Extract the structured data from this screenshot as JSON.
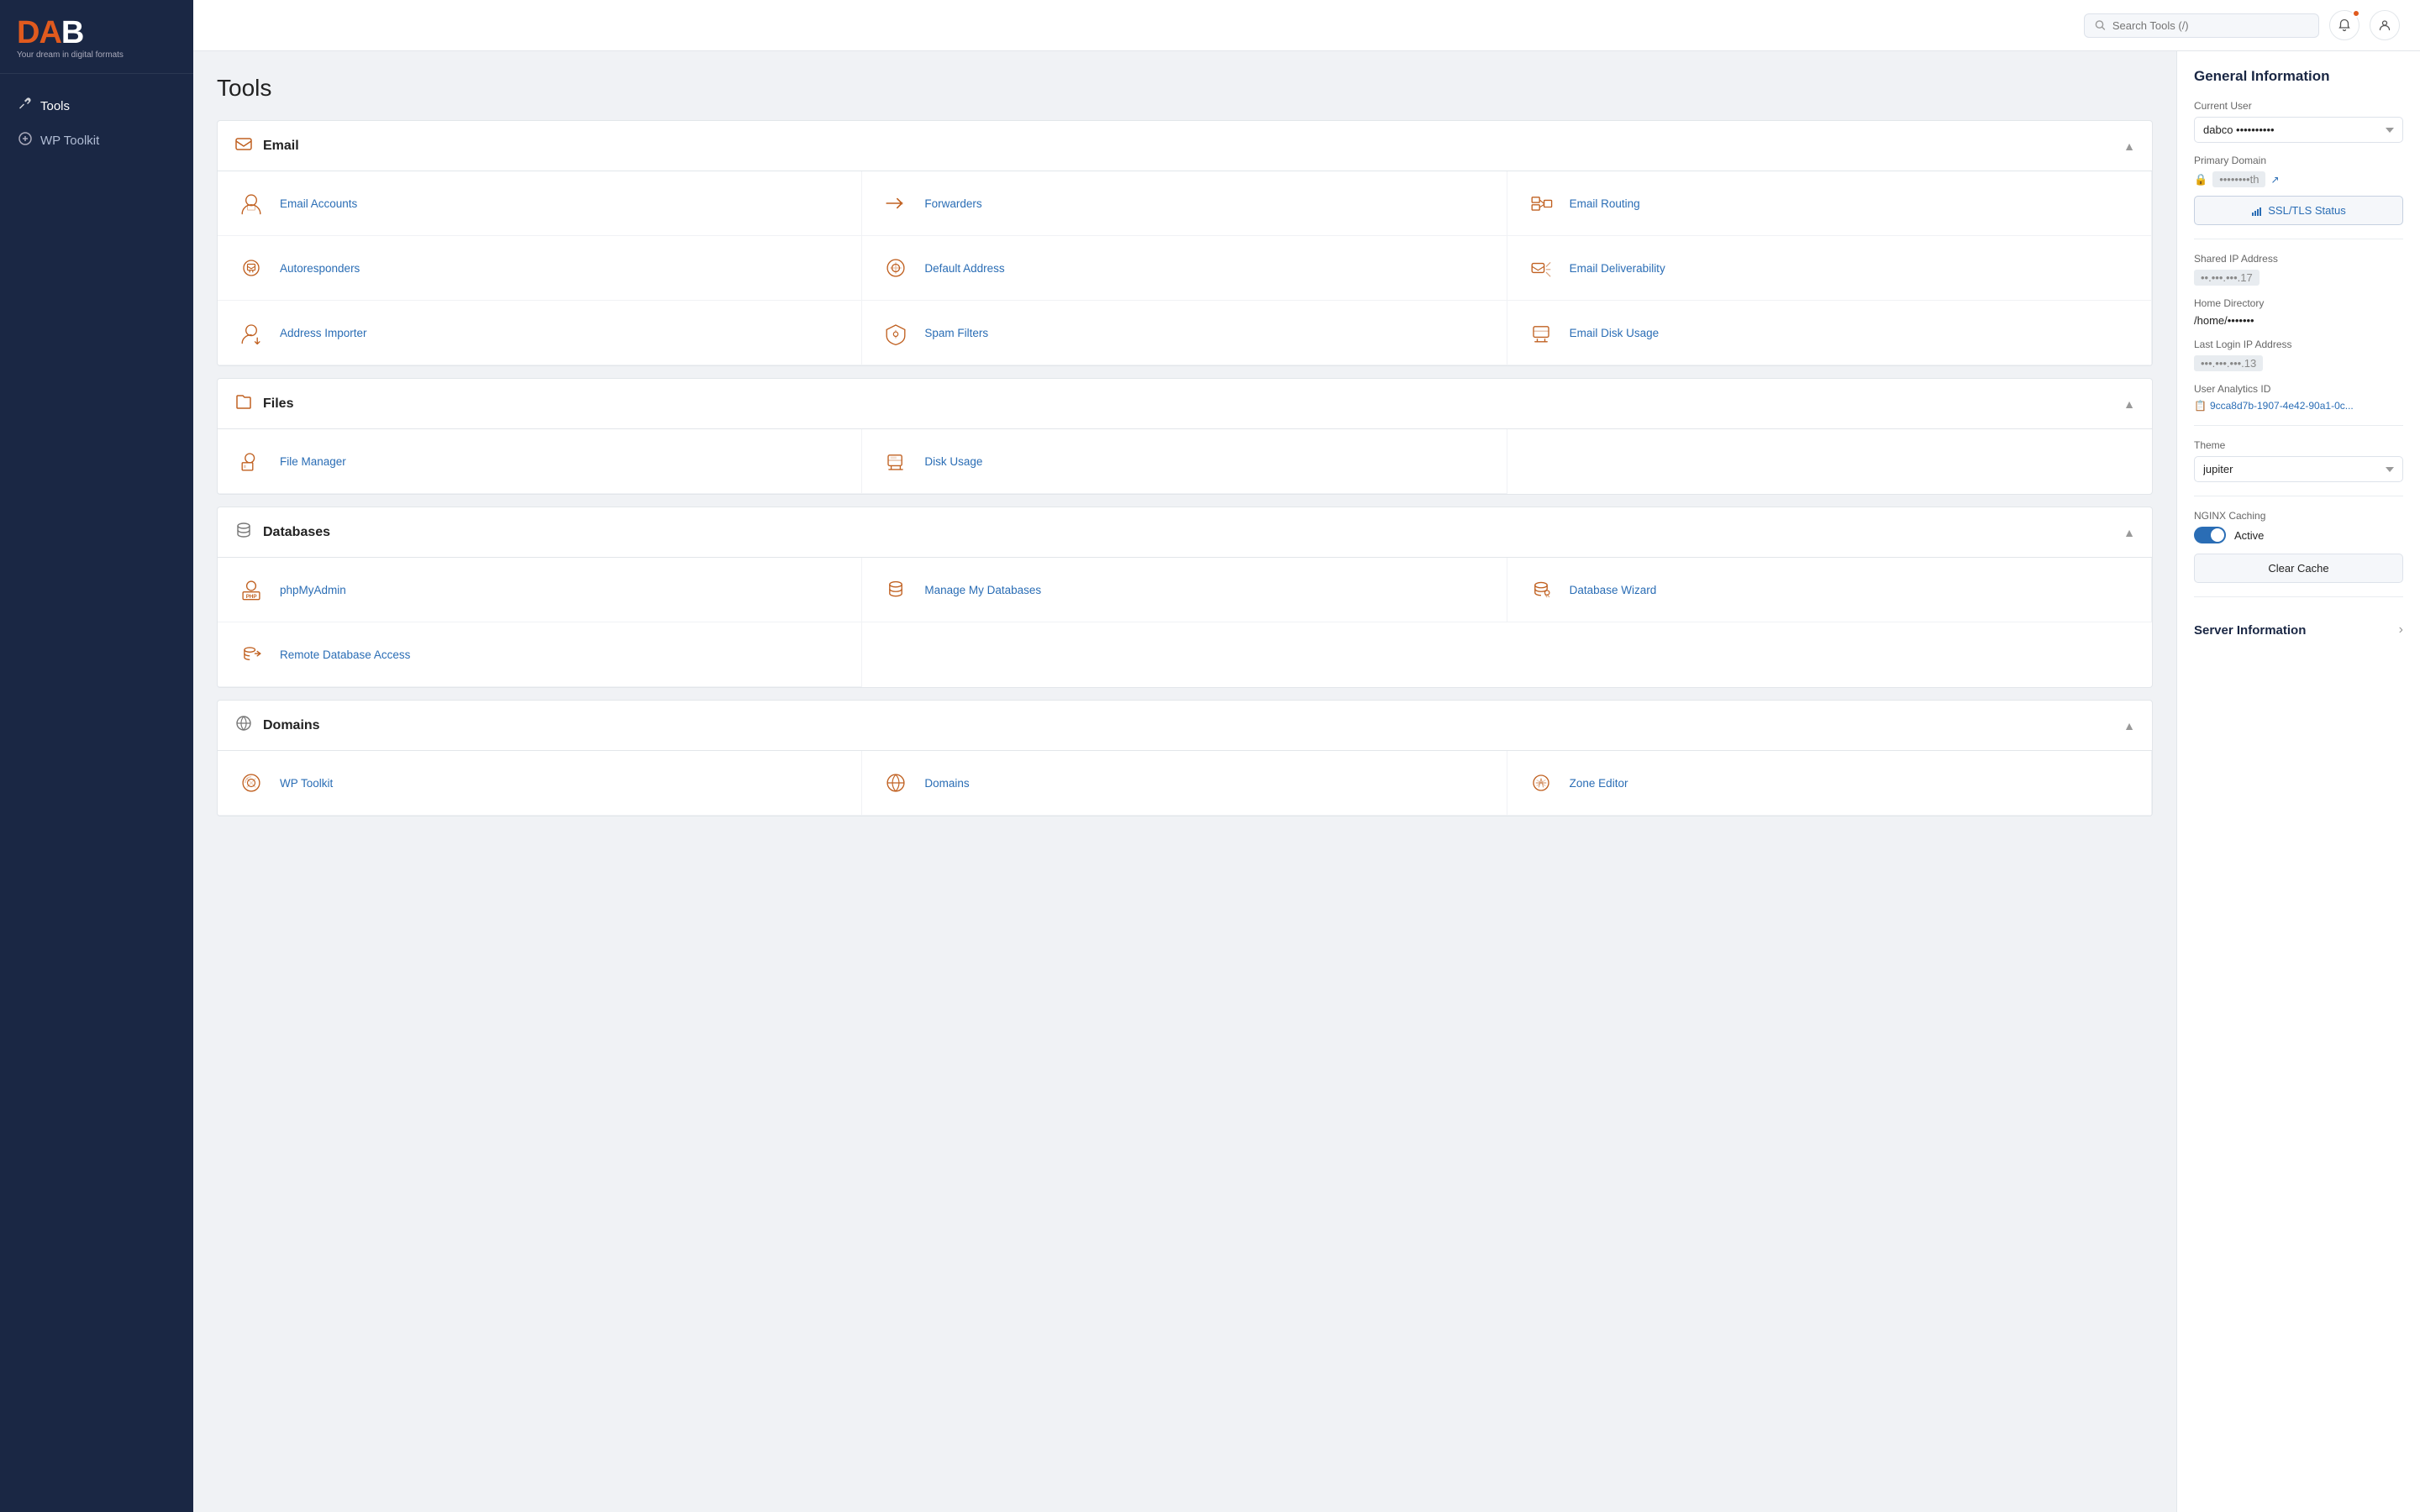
{
  "sidebar": {
    "brand": {
      "title": "DAB",
      "subtitle": "Your dream in digital formats"
    },
    "nav": [
      {
        "id": "tools",
        "label": "Tools",
        "icon": "✂",
        "active": true
      },
      {
        "id": "wp-toolkit",
        "label": "WP Toolkit",
        "icon": "⊞",
        "active": false
      }
    ]
  },
  "topbar": {
    "search_placeholder": "Search Tools (/)"
  },
  "page": {
    "title": "Tools"
  },
  "sections": [
    {
      "id": "email",
      "title": "Email",
      "icon": "email",
      "expanded": true,
      "items": [
        {
          "id": "email-accounts",
          "label": "Email Accounts",
          "icon": "email-accounts"
        },
        {
          "id": "forwarders",
          "label": "Forwarders",
          "icon": "forwarders"
        },
        {
          "id": "email-routing",
          "label": "Email Routing",
          "icon": "email-routing"
        },
        {
          "id": "autoresponders",
          "label": "Autoresponders",
          "icon": "autoresponders"
        },
        {
          "id": "default-address",
          "label": "Default Address",
          "icon": "default-address"
        },
        {
          "id": "email-deliverability",
          "label": "Email Deliverability",
          "icon": "email-deliverability"
        },
        {
          "id": "address-importer",
          "label": "Address Importer",
          "icon": "address-importer"
        },
        {
          "id": "spam-filters",
          "label": "Spam Filters",
          "icon": "spam-filters"
        },
        {
          "id": "email-disk-usage",
          "label": "Email Disk Usage",
          "icon": "email-disk-usage"
        }
      ]
    },
    {
      "id": "files",
      "title": "Files",
      "icon": "files",
      "expanded": true,
      "items": [
        {
          "id": "file-manager",
          "label": "File Manager",
          "icon": "file-manager"
        },
        {
          "id": "disk-usage",
          "label": "Disk Usage",
          "icon": "disk-usage"
        }
      ]
    },
    {
      "id": "databases",
      "title": "Databases",
      "icon": "databases",
      "expanded": true,
      "items": [
        {
          "id": "phpmyadmin",
          "label": "phpMyAdmin",
          "icon": "phpmyadmin"
        },
        {
          "id": "manage-databases",
          "label": "Manage My Databases",
          "icon": "manage-databases"
        },
        {
          "id": "database-wizard",
          "label": "Database Wizard",
          "icon": "database-wizard"
        },
        {
          "id": "remote-db-access",
          "label": "Remote Database Access",
          "icon": "remote-db-access"
        }
      ]
    },
    {
      "id": "domains",
      "title": "Domains",
      "icon": "domains",
      "expanded": true,
      "items": [
        {
          "id": "wp-toolkit-item",
          "label": "WP Toolkit",
          "icon": "wp-toolkit"
        },
        {
          "id": "domains-item",
          "label": "Domains",
          "icon": "domains-item"
        },
        {
          "id": "zone-editor",
          "label": "Zone Editor",
          "icon": "zone-editor"
        }
      ]
    }
  ],
  "right_panel": {
    "title": "General Information",
    "current_user_label": "Current User",
    "current_user_value": "dabco ••••••••••",
    "primary_domain_label": "Primary Domain",
    "primary_domain_value": "••••••••th",
    "ssl_tls_label": "SSL/TLS Status",
    "shared_ip_label": "Shared IP Address",
    "shared_ip_value": "••.•••.•••.17",
    "home_dir_label": "Home Directory",
    "home_dir_value": "/home/•••••••",
    "last_login_label": "Last Login IP Address",
    "last_login_value": "•••.•••.•••.13",
    "analytics_label": "User Analytics ID",
    "analytics_value": "9cca8d7b-1907-4e42-90a1-0c...",
    "theme_label": "Theme",
    "theme_value": "jupiter",
    "nginx_label": "NGINX Caching",
    "nginx_status": "Active",
    "clear_cache_label": "Clear Cache",
    "server_info_label": "Server Information"
  }
}
